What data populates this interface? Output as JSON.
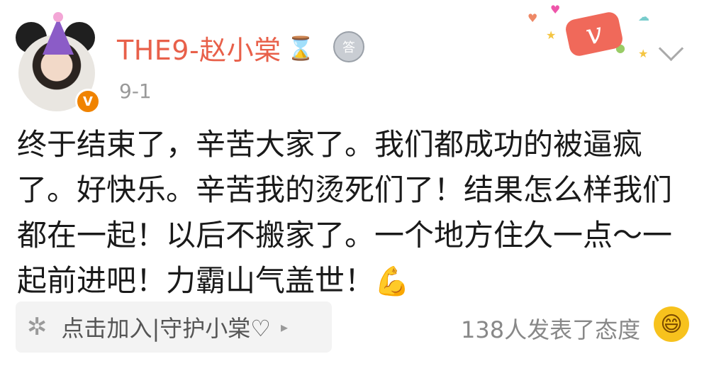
{
  "user": {
    "name": "THE9-赵小棠",
    "date": "9-1",
    "verified_badge": "V",
    "medal_label": "答",
    "hourglass_icon": "hourglass-icon"
  },
  "post": {
    "text": "终于结束了，辛苦大家了。我们都成功的被逼疯\n了。好快乐。辛苦我的烫死们了！结果怎么样我们\n都在一起！以后不搬家了。一个地方住久一点～一\n起前进吧！力霸山气盖世！",
    "emoji": "💪"
  },
  "footer": {
    "guard_label": "点击加入|守护小棠♡",
    "guard_arrow": "▸",
    "reactions": "138人发表了态度",
    "smile_icon": "😄"
  },
  "colors": {
    "username": "#e8604a",
    "guard_bg": "#f3f3f3"
  }
}
